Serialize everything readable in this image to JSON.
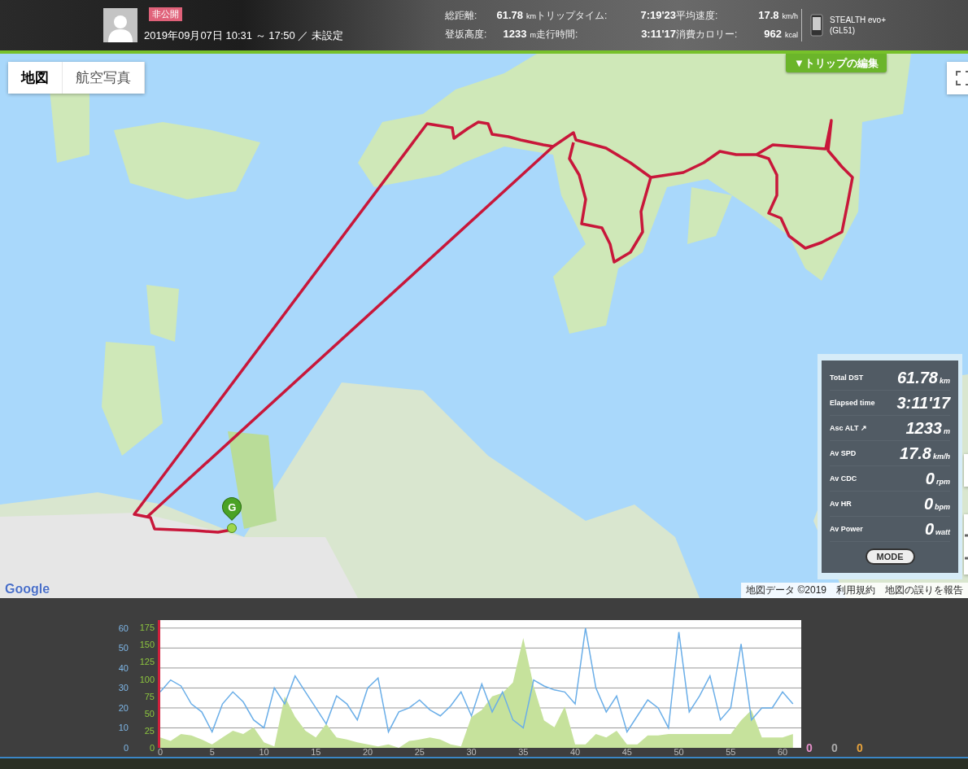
{
  "header": {
    "badge": "非公開",
    "date": "2019年09月07日 10:31 ～ 17:50 ／ 未設定",
    "stats": [
      {
        "label": "総距離:",
        "value": "61.78",
        "unit": "km"
      },
      {
        "label": "トリップタイム:",
        "value": "7:19'23"
      },
      {
        "label": "平均速度:",
        "value": "17.8",
        "unit": "km/h"
      },
      {
        "label": "登坂高度:",
        "value": "1233",
        "unit": "m"
      },
      {
        "label": "走行時間:",
        "value": "3:11'17"
      },
      {
        "label": "消費カロリー:",
        "value": "962",
        "unit": "kcal"
      }
    ],
    "device": {
      "name": "STEALTH evo+",
      "model": "(GL51)"
    }
  },
  "map": {
    "tabs": [
      {
        "label": "地図",
        "selected": true
      },
      {
        "label": "航空写真",
        "selected": false
      }
    ],
    "edit_button": "▼トリップの編集",
    "goal_marker": "G",
    "logo": "Google",
    "attribution": [
      "地図データ ©2019",
      "利用規約",
      "地図の誤りを報告"
    ],
    "summary": {
      "rows": [
        {
          "label": "Total DST",
          "value": "61.78",
          "unit": "km"
        },
        {
          "label": "Elapsed time",
          "value": "3:11'17"
        },
        {
          "label": "Asc ALT ↗",
          "value": "1233",
          "unit": "m"
        },
        {
          "label": "Av SPD",
          "value": "17.8",
          "unit": "km/h"
        },
        {
          "label": "Av CDC",
          "value": "0",
          "unit": "rpm"
        },
        {
          "label": "Av HR",
          "value": "0",
          "unit": "bpm"
        },
        {
          "label": "Av Power",
          "value": "0",
          "unit": "watt"
        }
      ],
      "mode_button": "MODE"
    }
  },
  "profile": {
    "chart_data": {
      "type": "line",
      "x": [
        0,
        1,
        2,
        3,
        4,
        5,
        6,
        7,
        8,
        9,
        10,
        11,
        12,
        13,
        14,
        15,
        16,
        17,
        18,
        19,
        20,
        21,
        22,
        23,
        24,
        25,
        26,
        27,
        28,
        29,
        30,
        31,
        32,
        33,
        34,
        35,
        36,
        37,
        38,
        39,
        40,
        41,
        42,
        43,
        44,
        45,
        46,
        47,
        48,
        49,
        50,
        51,
        52,
        53,
        54,
        55,
        56,
        57,
        58,
        59,
        60,
        61
      ],
      "xlim": [
        0,
        61.8
      ],
      "xticks": [
        0,
        5,
        10,
        15,
        20,
        25,
        30,
        35,
        40,
        45,
        50,
        55,
        60
      ],
      "grid": true,
      "ylim": [
        0,
        64
      ],
      "yticks": [
        0,
        10,
        20,
        30,
        40,
        50,
        60
      ],
      "y2lim": [
        0,
        186
      ],
      "y2ticks": [
        0,
        25,
        50,
        75,
        100,
        125,
        150,
        175
      ],
      "series": [
        {
          "type": "area",
          "axis": "y2",
          "color": "#c6e29c",
          "values": [
            15,
            10,
            20,
            18,
            12,
            5,
            15,
            25,
            20,
            30,
            8,
            2,
            75,
            45,
            25,
            15,
            35,
            15,
            12,
            8,
            5,
            2,
            5,
            0,
            10,
            12,
            15,
            12,
            5,
            2,
            45,
            55,
            75,
            80,
            95,
            160,
            90,
            40,
            30,
            60,
            5,
            5,
            20,
            15,
            25,
            5,
            5,
            18,
            18,
            20,
            20,
            20,
            20,
            20,
            20,
            20,
            40,
            55,
            15,
            15,
            15,
            20
          ]
        },
        {
          "type": "line",
          "color": "#6aaee8",
          "values": [
            28,
            34,
            31,
            22,
            18,
            8,
            22,
            28,
            23,
            14,
            10,
            30,
            22,
            36,
            28,
            20,
            12,
            26,
            22,
            14,
            30,
            35,
            8,
            18,
            20,
            24,
            19,
            16,
            21,
            28,
            16,
            32,
            18,
            28,
            14,
            10,
            34,
            31,
            29,
            28,
            22,
            60,
            30,
            18,
            26,
            8,
            16,
            24,
            20,
            10,
            58,
            18,
            26,
            36,
            14,
            20,
            52,
            14,
            20,
            20,
            28,
            22
          ]
        }
      ]
    },
    "readouts": [
      {
        "value": "0",
        "color": "#e58fc9"
      },
      {
        "value": "0",
        "color": "#aaaaaa"
      },
      {
        "value": "0",
        "color": "#e8a33c"
      }
    ]
  }
}
